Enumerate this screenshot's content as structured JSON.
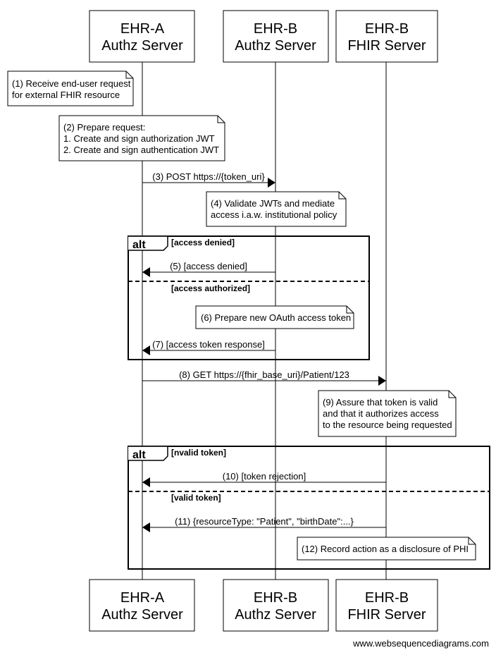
{
  "participants": [
    {
      "line1": "EHR-A",
      "line2": "Authz Server"
    },
    {
      "line1": "EHR-B",
      "line2": "Authz Server"
    },
    {
      "line1": "EHR-B",
      "line2": "FHIR Server"
    }
  ],
  "notes": [
    {
      "lines": [
        "(1) Receive end-user request",
        "for external FHIR resource"
      ]
    },
    {
      "lines": [
        "(2) Prepare request:",
        "1. Create and sign authorization JWT",
        "2. Create and sign authentication JWT"
      ]
    },
    {
      "lines": [
        "(4) Validate JWTs and mediate",
        "access i.a.w. institutional policy"
      ]
    },
    {
      "lines": [
        "(6) Prepare new OAuth access token"
      ]
    },
    {
      "lines": [
        "(9) Assure that token is valid",
        "and that it authorizes access",
        "to the resource being requested"
      ]
    },
    {
      "lines": [
        "(12) Record action as a disclosure of PHI"
      ]
    }
  ],
  "messages": [
    {
      "label": "(3) POST https://{token_uri}",
      "from": 0,
      "to": 1
    },
    {
      "label": "(5) [access denied]",
      "from": 1,
      "to": 0
    },
    {
      "label": "(7) [access token response]",
      "from": 1,
      "to": 0
    },
    {
      "label": "(8) GET https://{fhir_base_uri}/Patient/123",
      "from": 0,
      "to": 2
    },
    {
      "label": "(10) [token rejection]",
      "from": 2,
      "to": 0
    },
    {
      "label": "(11) {resourceType: \"Patient\", \"birthDate\":...}",
      "from": 2,
      "to": 0
    }
  ],
  "fragments": [
    {
      "type": "alt",
      "guards": [
        "[access denied]",
        "[access authorized]"
      ]
    },
    {
      "type": "alt",
      "guards": [
        "[nvalid token]",
        "[valid token]"
      ]
    }
  ],
  "footer": "www.websequencediagrams.com"
}
